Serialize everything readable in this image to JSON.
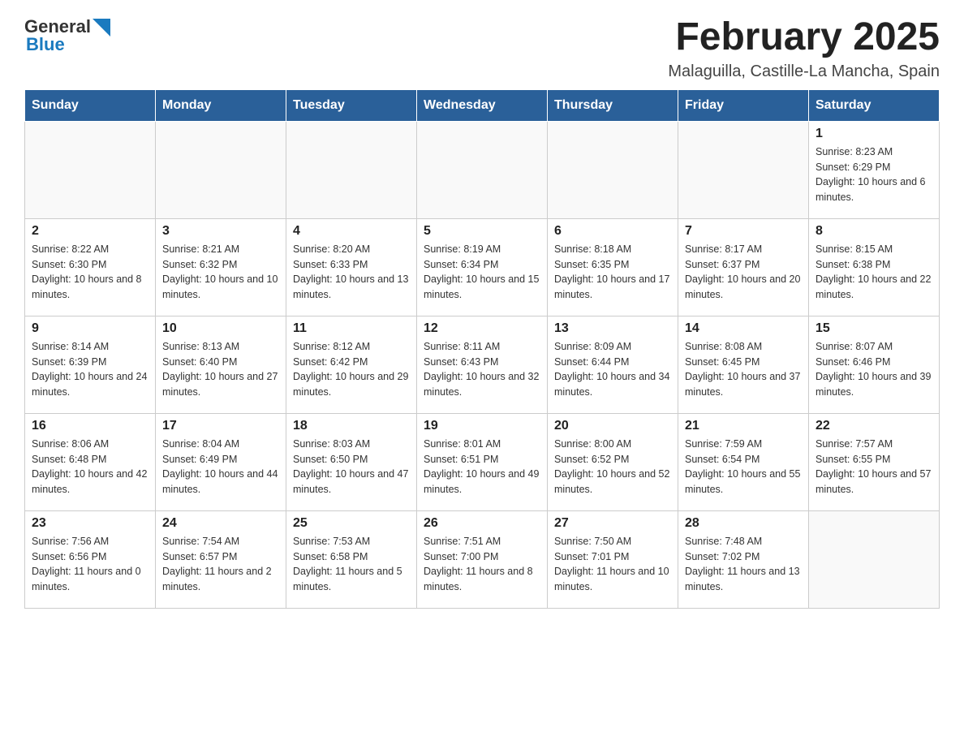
{
  "header": {
    "logo": {
      "text_general": "General",
      "text_blue": "Blue"
    },
    "title": "February 2025",
    "location": "Malaguilla, Castille-La Mancha, Spain"
  },
  "days_of_week": [
    "Sunday",
    "Monday",
    "Tuesday",
    "Wednesday",
    "Thursday",
    "Friday",
    "Saturday"
  ],
  "weeks": [
    [
      null,
      null,
      null,
      null,
      null,
      null,
      {
        "day": "1",
        "sunrise": "Sunrise: 8:23 AM",
        "sunset": "Sunset: 6:29 PM",
        "daylight": "Daylight: 10 hours and 6 minutes."
      }
    ],
    [
      {
        "day": "2",
        "sunrise": "Sunrise: 8:22 AM",
        "sunset": "Sunset: 6:30 PM",
        "daylight": "Daylight: 10 hours and 8 minutes."
      },
      {
        "day": "3",
        "sunrise": "Sunrise: 8:21 AM",
        "sunset": "Sunset: 6:32 PM",
        "daylight": "Daylight: 10 hours and 10 minutes."
      },
      {
        "day": "4",
        "sunrise": "Sunrise: 8:20 AM",
        "sunset": "Sunset: 6:33 PM",
        "daylight": "Daylight: 10 hours and 13 minutes."
      },
      {
        "day": "5",
        "sunrise": "Sunrise: 8:19 AM",
        "sunset": "Sunset: 6:34 PM",
        "daylight": "Daylight: 10 hours and 15 minutes."
      },
      {
        "day": "6",
        "sunrise": "Sunrise: 8:18 AM",
        "sunset": "Sunset: 6:35 PM",
        "daylight": "Daylight: 10 hours and 17 minutes."
      },
      {
        "day": "7",
        "sunrise": "Sunrise: 8:17 AM",
        "sunset": "Sunset: 6:37 PM",
        "daylight": "Daylight: 10 hours and 20 minutes."
      },
      {
        "day": "8",
        "sunrise": "Sunrise: 8:15 AM",
        "sunset": "Sunset: 6:38 PM",
        "daylight": "Daylight: 10 hours and 22 minutes."
      }
    ],
    [
      {
        "day": "9",
        "sunrise": "Sunrise: 8:14 AM",
        "sunset": "Sunset: 6:39 PM",
        "daylight": "Daylight: 10 hours and 24 minutes."
      },
      {
        "day": "10",
        "sunrise": "Sunrise: 8:13 AM",
        "sunset": "Sunset: 6:40 PM",
        "daylight": "Daylight: 10 hours and 27 minutes."
      },
      {
        "day": "11",
        "sunrise": "Sunrise: 8:12 AM",
        "sunset": "Sunset: 6:42 PM",
        "daylight": "Daylight: 10 hours and 29 minutes."
      },
      {
        "day": "12",
        "sunrise": "Sunrise: 8:11 AM",
        "sunset": "Sunset: 6:43 PM",
        "daylight": "Daylight: 10 hours and 32 minutes."
      },
      {
        "day": "13",
        "sunrise": "Sunrise: 8:09 AM",
        "sunset": "Sunset: 6:44 PM",
        "daylight": "Daylight: 10 hours and 34 minutes."
      },
      {
        "day": "14",
        "sunrise": "Sunrise: 8:08 AM",
        "sunset": "Sunset: 6:45 PM",
        "daylight": "Daylight: 10 hours and 37 minutes."
      },
      {
        "day": "15",
        "sunrise": "Sunrise: 8:07 AM",
        "sunset": "Sunset: 6:46 PM",
        "daylight": "Daylight: 10 hours and 39 minutes."
      }
    ],
    [
      {
        "day": "16",
        "sunrise": "Sunrise: 8:06 AM",
        "sunset": "Sunset: 6:48 PM",
        "daylight": "Daylight: 10 hours and 42 minutes."
      },
      {
        "day": "17",
        "sunrise": "Sunrise: 8:04 AM",
        "sunset": "Sunset: 6:49 PM",
        "daylight": "Daylight: 10 hours and 44 minutes."
      },
      {
        "day": "18",
        "sunrise": "Sunrise: 8:03 AM",
        "sunset": "Sunset: 6:50 PM",
        "daylight": "Daylight: 10 hours and 47 minutes."
      },
      {
        "day": "19",
        "sunrise": "Sunrise: 8:01 AM",
        "sunset": "Sunset: 6:51 PM",
        "daylight": "Daylight: 10 hours and 49 minutes."
      },
      {
        "day": "20",
        "sunrise": "Sunrise: 8:00 AM",
        "sunset": "Sunset: 6:52 PM",
        "daylight": "Daylight: 10 hours and 52 minutes."
      },
      {
        "day": "21",
        "sunrise": "Sunrise: 7:59 AM",
        "sunset": "Sunset: 6:54 PM",
        "daylight": "Daylight: 10 hours and 55 minutes."
      },
      {
        "day": "22",
        "sunrise": "Sunrise: 7:57 AM",
        "sunset": "Sunset: 6:55 PM",
        "daylight": "Daylight: 10 hours and 57 minutes."
      }
    ],
    [
      {
        "day": "23",
        "sunrise": "Sunrise: 7:56 AM",
        "sunset": "Sunset: 6:56 PM",
        "daylight": "Daylight: 11 hours and 0 minutes."
      },
      {
        "day": "24",
        "sunrise": "Sunrise: 7:54 AM",
        "sunset": "Sunset: 6:57 PM",
        "daylight": "Daylight: 11 hours and 2 minutes."
      },
      {
        "day": "25",
        "sunrise": "Sunrise: 7:53 AM",
        "sunset": "Sunset: 6:58 PM",
        "daylight": "Daylight: 11 hours and 5 minutes."
      },
      {
        "day": "26",
        "sunrise": "Sunrise: 7:51 AM",
        "sunset": "Sunset: 7:00 PM",
        "daylight": "Daylight: 11 hours and 8 minutes."
      },
      {
        "day": "27",
        "sunrise": "Sunrise: 7:50 AM",
        "sunset": "Sunset: 7:01 PM",
        "daylight": "Daylight: 11 hours and 10 minutes."
      },
      {
        "day": "28",
        "sunrise": "Sunrise: 7:48 AM",
        "sunset": "Sunset: 7:02 PM",
        "daylight": "Daylight: 11 hours and 13 minutes."
      },
      null
    ]
  ]
}
